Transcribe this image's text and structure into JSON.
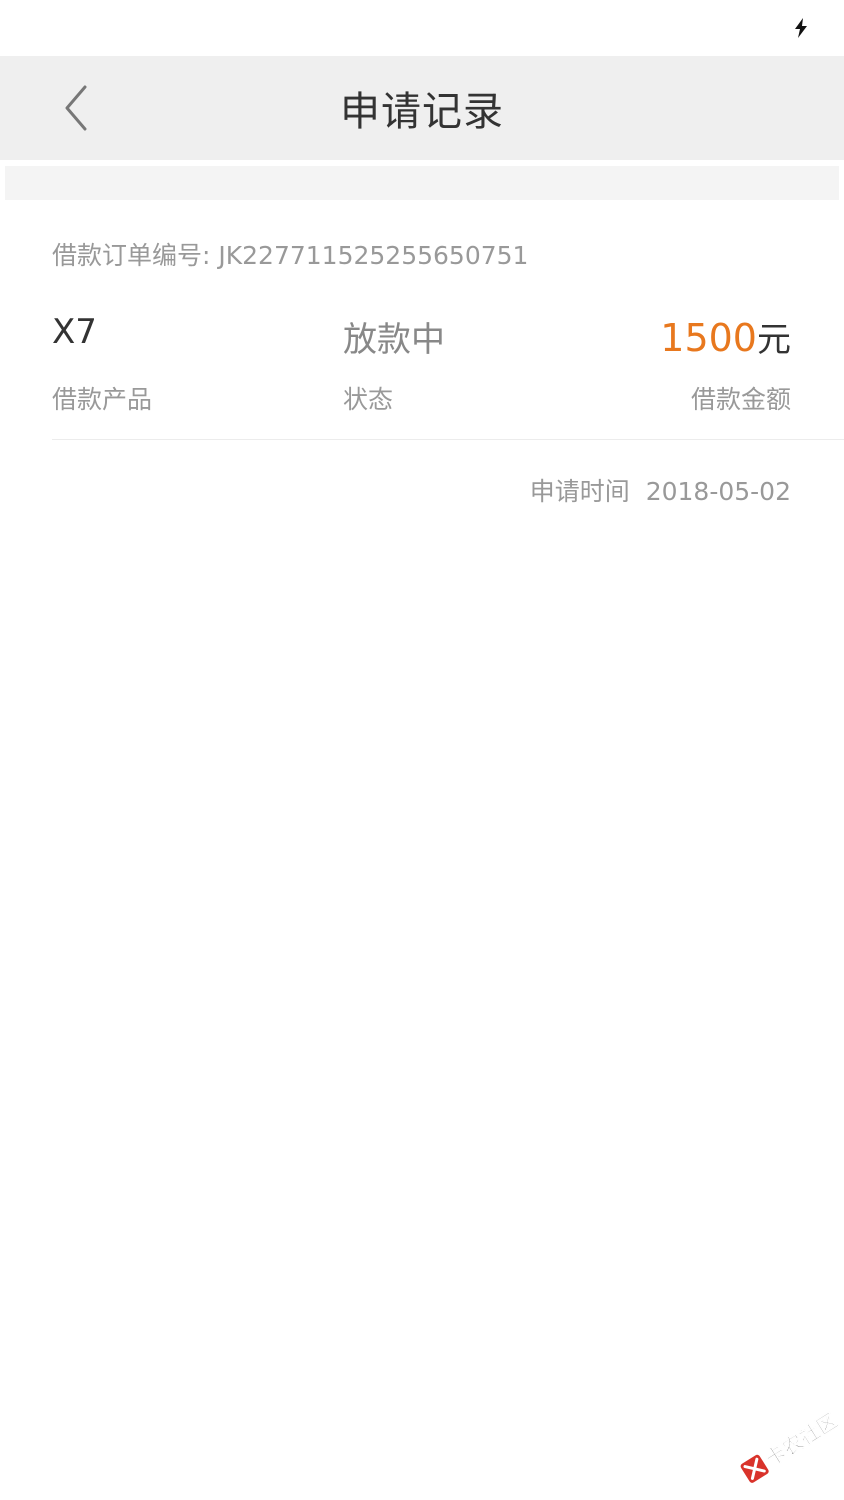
{
  "header": {
    "title": "申请记录"
  },
  "record": {
    "order_number": "借款订单编号: JK227711525255650751",
    "product_value": "X7",
    "product_label": "借款产品",
    "status_value": "放款中",
    "status_label": "状态",
    "amount_number": "1500",
    "amount_unit": "元",
    "amount_label": "借款金额",
    "apply_time_label": "申请时间",
    "apply_time_value": "2018-05-02"
  },
  "watermark": {
    "text": "卡农社区"
  },
  "colors": {
    "header_bg": "#efefef",
    "accent_amount": "#e8781e",
    "primary_text": "#333333",
    "secondary_text": "#999999"
  },
  "icons": {
    "back": "chevron-left-icon",
    "status": "charging-icon"
  }
}
